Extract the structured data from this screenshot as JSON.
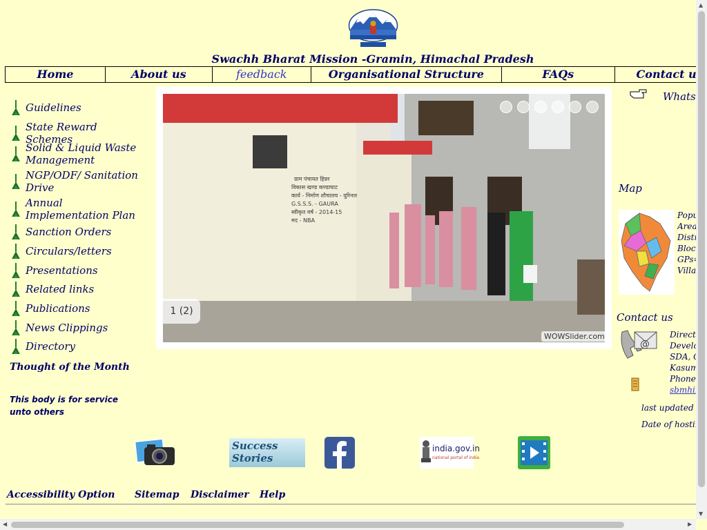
{
  "header": {
    "site_title": "Swachh Bharat Mission -Gramin, Himachal Pradesh"
  },
  "nav": {
    "items": [
      {
        "label": "Home"
      },
      {
        "label": "About us"
      },
      {
        "label": "feedback"
      },
      {
        "label": "Organisational Structure"
      },
      {
        "label": "FAQs"
      },
      {
        "label": "Contact us"
      }
    ]
  },
  "left_nav": {
    "items": [
      {
        "label": "Guidelines"
      },
      {
        "label": "State Reward Schemes"
      },
      {
        "label": "Solid & Liquid Waste Management"
      },
      {
        "label": "NGP/ODF/ Sanitation Drive"
      },
      {
        "label": "Annual Implementation Plan"
      },
      {
        "label": "Sanction Orders"
      },
      {
        "label": "Circulars/letters"
      },
      {
        "label": "Presentations"
      },
      {
        "label": "Related links"
      },
      {
        "label": "Publications"
      },
      {
        "label": "News Clippings"
      },
      {
        "label": "Directory"
      }
    ],
    "thought_title": "Thought of the Month",
    "thought_text": "This body is for service unto others"
  },
  "slider": {
    "counter": "1 (2)",
    "watermark": "WOWSlider.com",
    "wall_text": [
      "ग्राम पंचायत हिन्नर",
      "विकास खण्ड कण्डाघाट",
      "कार्य - निर्माण शौचालय - युरिनल",
      "G.S.S.S. - GAURA",
      "स्वीकृत वर्ष - 2014-15",
      "मद - NBA"
    ]
  },
  "right_col": {
    "whats_new": "Whats New",
    "map_heading": "Map",
    "map_stats": [
      "Population",
      "Area=",
      "Districts",
      "Blocks",
      "GPs=",
      "Villages"
    ],
    "contact_heading": "Contact us",
    "contact_lines": [
      "Director",
      "Development",
      "SDA, C",
      "Kasumpti",
      "Phone."
    ],
    "contact_email": "sbmhim",
    "last_updated": "last updated on",
    "date_hosting": "Date of hosting"
  },
  "bottom_icons": {
    "success_stories": "Success Stories",
    "india_gov": "india.gov.in",
    "india_gov_sub": "national portal of india"
  },
  "footer": {
    "accessibility": "Accessibility Option",
    "sitemap": "Sitemap",
    "disclaimer": "Disclaimer",
    "help": "Help"
  }
}
